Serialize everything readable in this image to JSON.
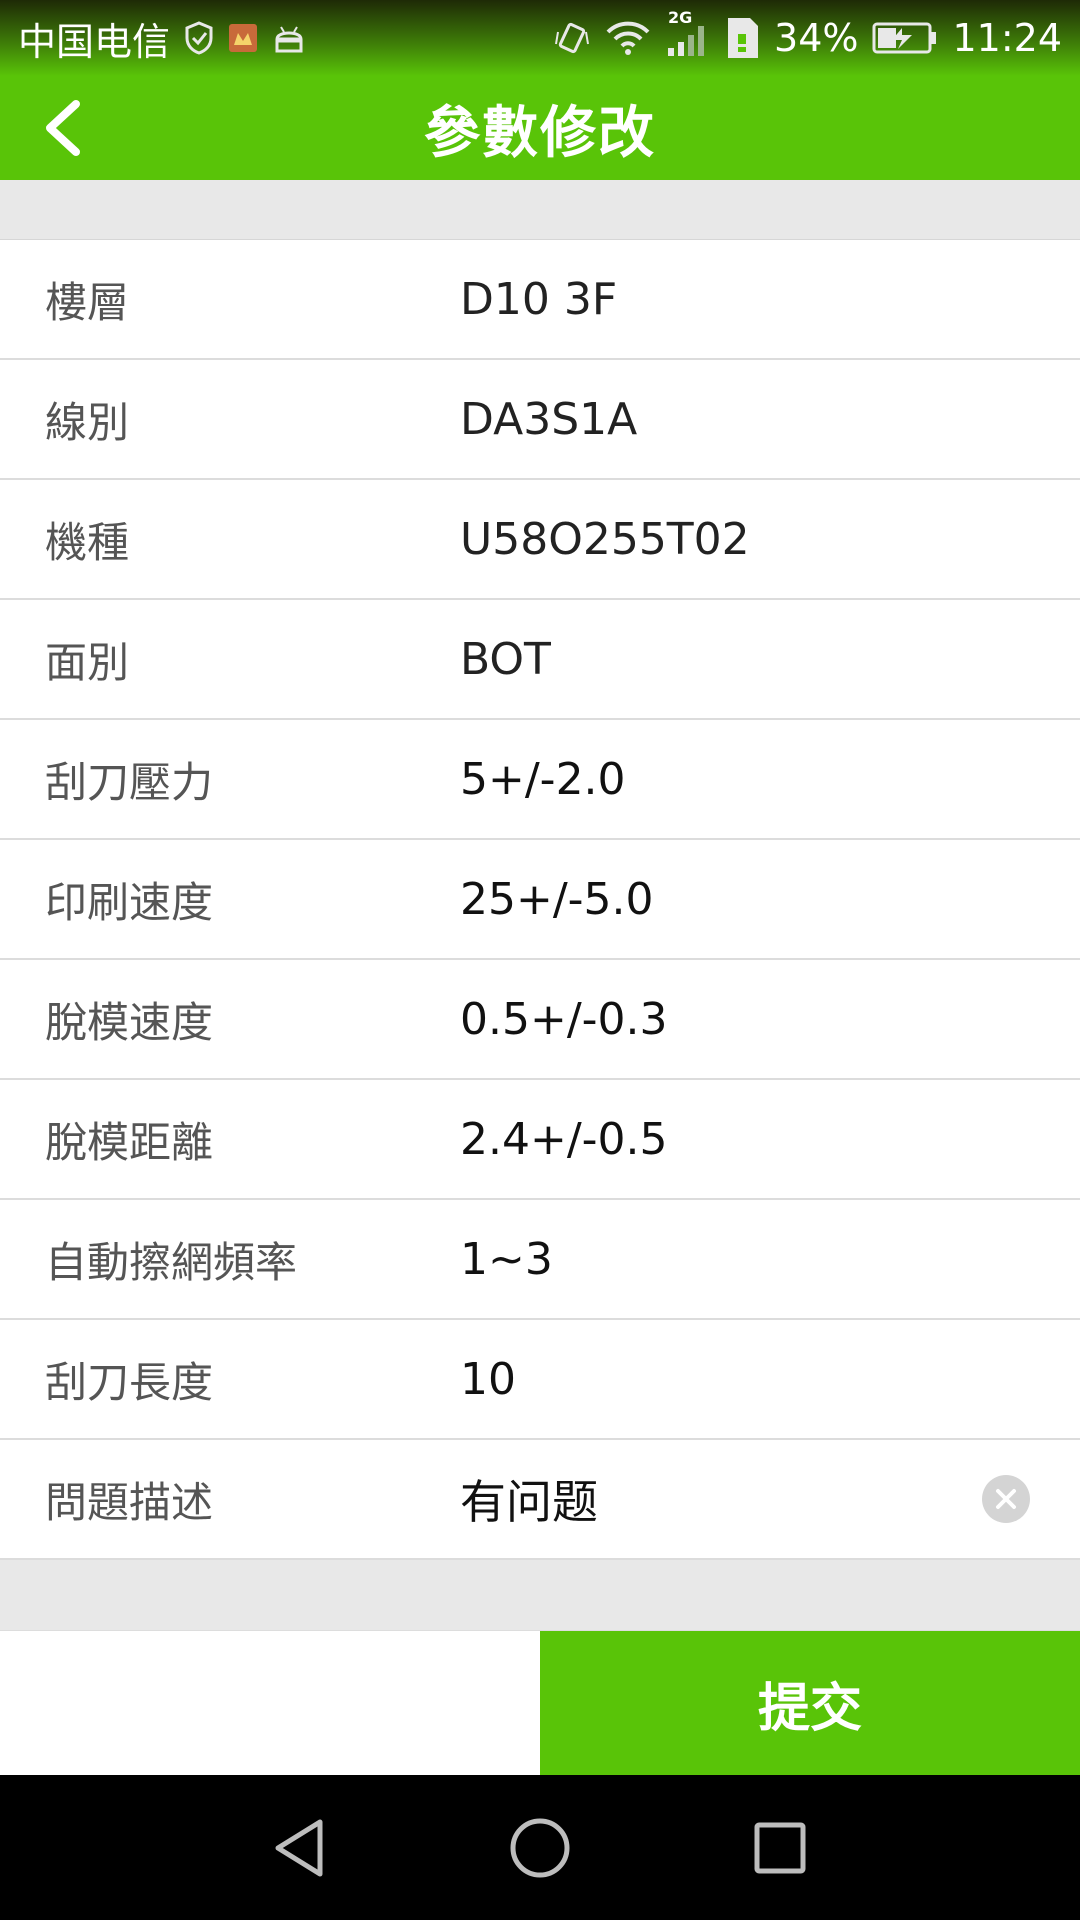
{
  "status_bar": {
    "carrier": "中国电信",
    "network": "2G",
    "battery": "34%",
    "time": "11:24",
    "icons": [
      "shield-check-icon",
      "app-notification-icon",
      "android-icon",
      "vibrate-icon",
      "wifi-icon",
      "signal-icon",
      "sim-icon",
      "battery-charging-icon"
    ]
  },
  "header": {
    "title": "參數修改",
    "back_icon": "chevron-left-icon"
  },
  "form": {
    "rows": [
      {
        "label": "樓層",
        "value": "D10 3F"
      },
      {
        "label": "線別",
        "value": "DA3S1A"
      },
      {
        "label": "機種",
        "value": "U58O255T02"
      },
      {
        "label": "面別",
        "value": "BOT"
      },
      {
        "label": "刮刀壓力",
        "value": "5+/-2.0"
      },
      {
        "label": "印刷速度",
        "value": "25+/-5.0"
      },
      {
        "label": "脫模速度",
        "value": "0.5+/-0.3"
      },
      {
        "label": "脫模距離",
        "value": "2.4+/-0.5"
      },
      {
        "label": "自動擦網頻率",
        "value": "1~3"
      },
      {
        "label": "刮刀長度",
        "value": "10"
      }
    ],
    "problem": {
      "label": "問題描述",
      "value": "有问题",
      "clear_icon": "clear-icon"
    }
  },
  "actions": {
    "submit_label": "提交"
  },
  "nav_bar": {
    "icons": [
      "back-triangle-icon",
      "home-circle-icon",
      "recents-square-icon"
    ]
  },
  "colors": {
    "brand_green": "#59c408",
    "divider": "#dcdcdc",
    "spacer_gray": "#e8e8e8"
  }
}
